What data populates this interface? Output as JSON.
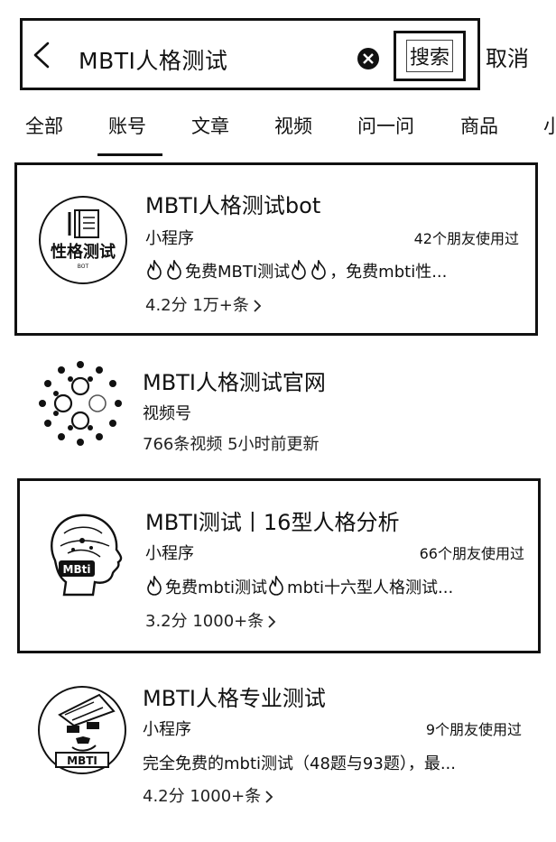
{
  "search": {
    "query": "MBTI人格测试",
    "search_label": "搜索",
    "cancel_label": "取消"
  },
  "tabs": [
    {
      "label": "全部",
      "active": false
    },
    {
      "label": "账号",
      "active": true
    },
    {
      "label": "文章",
      "active": false
    },
    {
      "label": "视频",
      "active": false
    },
    {
      "label": "问一问",
      "active": false
    },
    {
      "label": "商品",
      "active": false
    },
    {
      "label": "小",
      "active": false
    }
  ],
  "results": [
    {
      "title": "MBTI人格测试bot",
      "type": "小程序",
      "friends": "42个朋友使用过",
      "desc": "免费MBTI测试",
      "desc2": "，免费mbti性...",
      "meta": "4.2分 1万+条",
      "logo_text": "性格测试",
      "logo_sub": "BOT",
      "icon": "book-icon"
    },
    {
      "title": "MBTI人格测试官网",
      "type": "视频号",
      "meta": "766条视频  5小时前更新",
      "icon": "dots-circle-icon"
    },
    {
      "title": "MBTI测试丨16型人格分析",
      "type": "小程序",
      "friends": "66个朋友使用过",
      "desc": "免费mbti测试",
      "desc2": "mbti十六型人格测试...",
      "meta": "3.2分 1000+条",
      "logo_text": "MBti",
      "icon": "head-profile-icon"
    },
    {
      "title": "MBTI人格专业测试",
      "type": "小程序",
      "friends": "9个朋友使用过",
      "desc": "完全免费的mbti测试（48题与93题），最...",
      "meta": "4.2分 1000+条",
      "logo_text": "MBTI",
      "icon": "cartoon-face-icon"
    }
  ]
}
